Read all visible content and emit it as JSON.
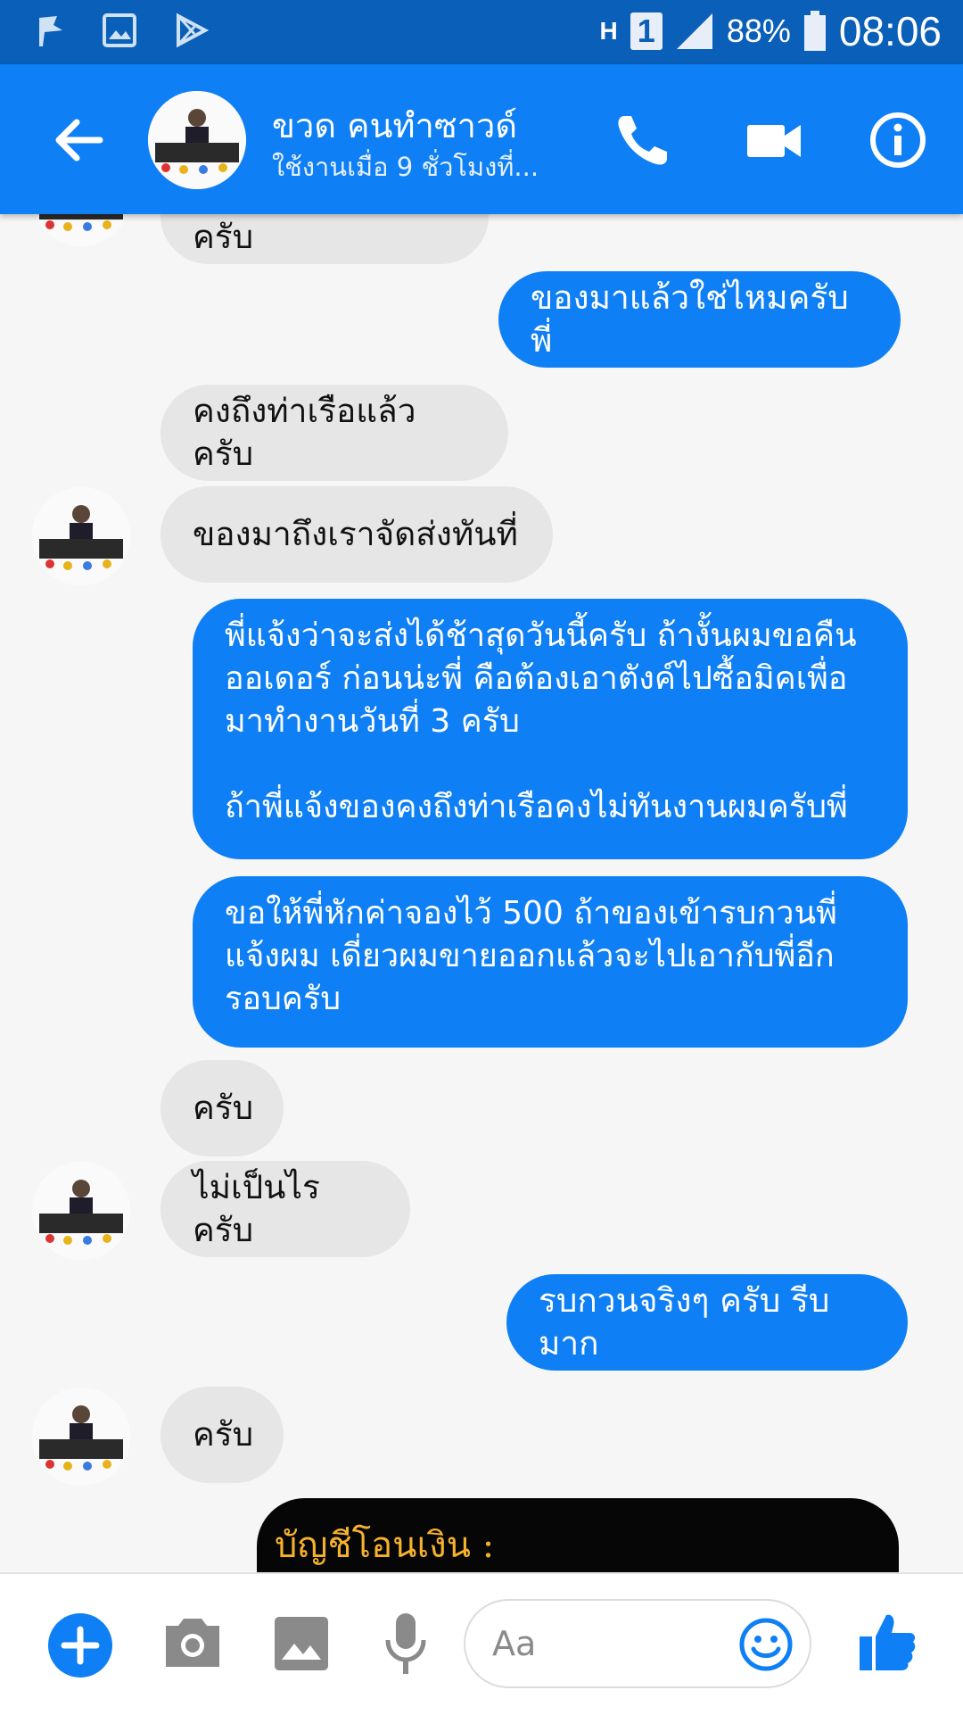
{
  "status_bar": {
    "network": "H",
    "sim": "1",
    "battery": "88%",
    "time": "08:06"
  },
  "header": {
    "contact_name": "ขวด คนทำซาวด์",
    "last_active": "ใช้งานเมื่อ 9 ชั่วโมงที่..."
  },
  "messages": [
    {
      "side": "in",
      "text": "คงจะเป็นวันจันทร์ครับ"
    },
    {
      "side": "out",
      "text": "ของมาแล้วใช่ไหมครับพี่"
    },
    {
      "side": "in",
      "text": "คงถึงท่าเรือแล้วครับ"
    },
    {
      "side": "in",
      "text": "ของมาถึงเราจัดส่งทันที่"
    },
    {
      "side": "out",
      "text": "พี่แจ้งว่าจะส่งได้ช้าสุดวันนี้ครับ ถ้างั้นผมขอคืน\nออเดอร์ ก่อนน่ะพี่ คือต้องเอาตังค์ไปซื้อมิคเพื่อ\nมาทำงานวันที่ 3 ครับ\n\nถ้าพี่แจ้งของคงถึงท่าเรือคงไม่ทันงานผมครับพี่"
    },
    {
      "side": "out",
      "text": "ขอให้พี่หักค่าจองไว้ 500 ถ้าของเข้ารบกวนพี่\nแจ้งผม เดี่ยวผมขายออกแล้วจะไปเอากับพี่อีก\nรอบครับ"
    },
    {
      "side": "in",
      "text": "ครับ"
    },
    {
      "side": "in",
      "text": "ไม่เป็นไรครับ"
    },
    {
      "side": "out",
      "text": "รบกวนจริงๆ ครับ รีบมาก"
    },
    {
      "side": "in",
      "text": "ครับ"
    }
  ],
  "image_card": {
    "text": "บัญชีโอนเงิน :"
  },
  "composer": {
    "placeholder": "Aa"
  },
  "colors": {
    "accent": "#0e7ff4",
    "status_bar": "#0a5fb8",
    "incoming_bubble": "#e6e6e6"
  },
  "icons": [
    "back-arrow-icon",
    "phone-icon",
    "video-camera-icon",
    "info-icon",
    "plus-icon",
    "camera-icon",
    "gallery-icon",
    "microphone-icon",
    "emoji-icon",
    "thumbs-up-icon"
  ]
}
